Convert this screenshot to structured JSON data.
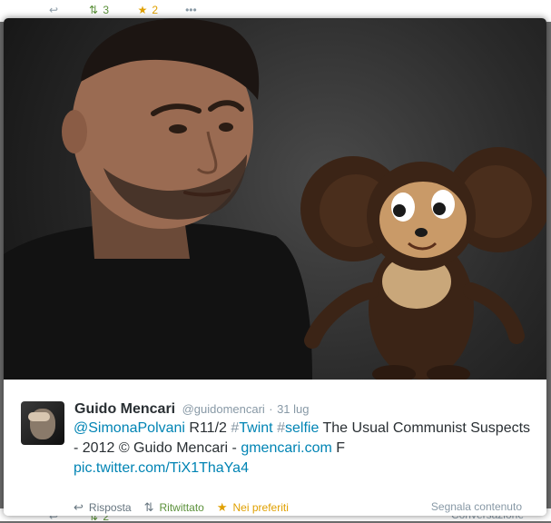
{
  "background_tweet_top": {
    "reply_icon": "reply-icon",
    "retweet_count": "3",
    "favorite_count": "2",
    "more_icon": "more-dots-icon"
  },
  "background_tweet_bottom": {
    "retweet_count": "2",
    "conversation_label": "Conversazione"
  },
  "media_overlay": {
    "image_description": "Man with raised eyebrow next to a Cheburashka plush toy",
    "author": {
      "fullname": "Guido Mencari",
      "username": "@guidomencari",
      "separator": "·",
      "timestamp": "31 lug"
    },
    "tweet": {
      "mention": "@SimonaPolvani",
      "text_1": " R11/2 ",
      "hashtag_1_symbol": "#",
      "hashtag_1": "Twint",
      "space": " ",
      "hashtag_2_symbol": "#",
      "hashtag_2": "selfie",
      "text_2": " The Usual Communist Suspects - 2012 © Guido Mencari - ",
      "link_1": "gmencari.com",
      "text_3": " F",
      "link_2": "pic.twitter.com/TiX1ThaYa4"
    },
    "actions": {
      "reply_label": "Risposta",
      "retweet_label": "Ritwittato",
      "favorite_label": "Nei preferiti",
      "report_label": "Segnala contenuto"
    }
  },
  "colors": {
    "link": "#0084b4",
    "retweeted": "#5c913b",
    "favorited": "#e0a000",
    "text": "#292f33",
    "muted": "#8899a6"
  }
}
